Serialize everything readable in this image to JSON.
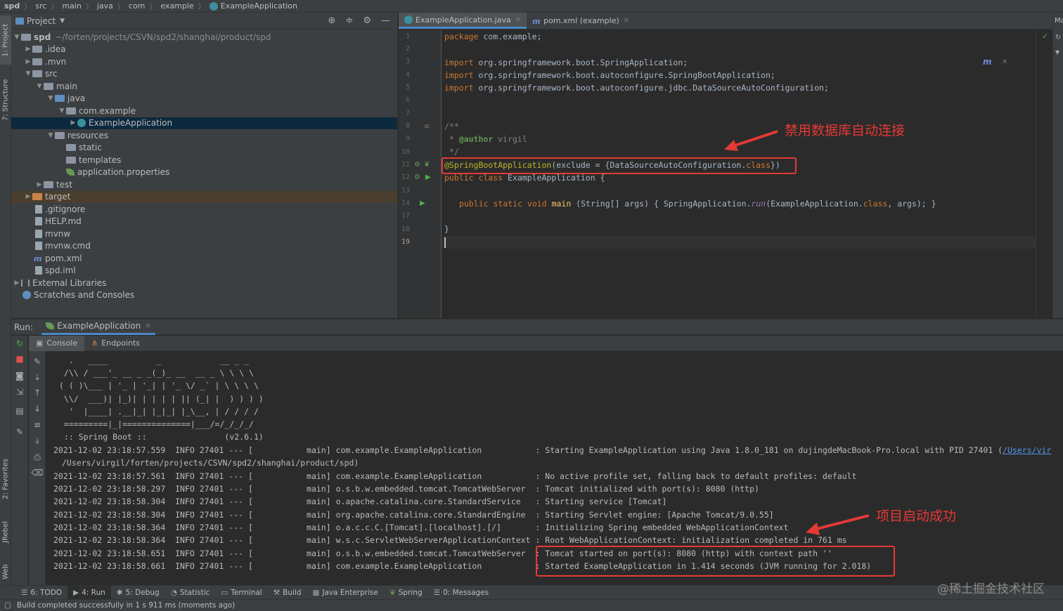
{
  "breadcrumb": [
    "spd",
    "src",
    "main",
    "java",
    "com",
    "example",
    "ExampleApplication"
  ],
  "left_stripe": {
    "project": "1: Project",
    "structure": "7: Structure",
    "favorites": "2: Favorites",
    "jrebel": "JRebel",
    "web": "Web"
  },
  "right_stripe": {
    "maven": "Ma"
  },
  "project_panel": {
    "title": "Project",
    "root_name": "spd",
    "root_path": "~/forten/projects/CSVN/spd2/shanghai/product/spd",
    "tree": [
      {
        "label": "spd",
        "icon": "folder-icon"
      },
      {
        "label": ".idea",
        "icon": "folder-icon"
      },
      {
        "label": ".mvn",
        "icon": "folder-icon"
      },
      {
        "label": "src",
        "icon": "folder-icon"
      },
      {
        "label": "main",
        "icon": "folder-icon"
      },
      {
        "label": "java",
        "icon": "source-folder-icon"
      },
      {
        "label": "com.example",
        "icon": "package-icon"
      },
      {
        "label": "ExampleApplication",
        "icon": "spring-class-icon"
      },
      {
        "label": "resources",
        "icon": "resources-folder-icon"
      },
      {
        "label": "static",
        "icon": "folder-icon"
      },
      {
        "label": "templates",
        "icon": "folder-icon"
      },
      {
        "label": "application.properties",
        "icon": "spring-properties-icon"
      },
      {
        "label": "test",
        "icon": "folder-icon"
      },
      {
        "label": "target",
        "icon": "excluded-folder-icon"
      },
      {
        "label": ".gitignore",
        "icon": "file-icon"
      },
      {
        "label": "HELP.md",
        "icon": "markdown-icon"
      },
      {
        "label": "mvnw",
        "icon": "shell-icon"
      },
      {
        "label": "mvnw.cmd",
        "icon": "file-icon"
      },
      {
        "label": "pom.xml",
        "icon": "maven-icon"
      },
      {
        "label": "spd.iml",
        "icon": "file-icon"
      },
      {
        "label": "External Libraries",
        "icon": "library-icon"
      },
      {
        "label": "Scratches and Consoles",
        "icon": "scratches-icon"
      }
    ]
  },
  "editor": {
    "tabs": [
      {
        "label": "ExampleApplication.java",
        "active": true
      },
      {
        "label": "pom.xml (example)",
        "active": false
      }
    ],
    "line_numbers": [
      "1",
      "2",
      "3",
      "4",
      "5",
      "6",
      "7",
      "8",
      "9",
      "10",
      "11",
      "12",
      "13",
      "14",
      "17",
      "18",
      "19"
    ],
    "code": {
      "l1_kw": "package",
      "l1_rest": " com.example;",
      "l3_kw": "import",
      "l3_rest": " org.springframework.boot.SpringApplication;",
      "l4_kw": "import",
      "l4_rest": " org.springframework.boot.autoconfigure.SpringBootApplication;",
      "l5_kw": "import",
      "l5_rest": " org.springframework.boot.autoconfigure.jdbc.DataSourceAutoConfiguration;",
      "l8": "/**",
      "l9_star": " * ",
      "l9_tag": "@author",
      "l9_name": " virgil",
      "l10": " */",
      "l11_ann": "@SpringBootApplication",
      "l11_mid": "(exclude = {DataSourceAutoConfiguration.",
      "l11_kw": "class",
      "l11_end": "})",
      "l12_kw": "public class",
      "l12_rest": " ExampleApplication {",
      "l14_kw": "public static void",
      "l14_main": "main",
      "l14_args": " (String[] args) { SpringApplication.",
      "l14_run": "run",
      "l14_mid": "(ExampleApplication.",
      "l14_kw2": "class",
      "l14_end": ", args); }",
      "l18": "}"
    },
    "annotation": "禁用数据库自动连接"
  },
  "run": {
    "label": "Run:",
    "config": "ExampleApplication",
    "tabs": [
      "Console",
      "Endpoints"
    ],
    "ascii": "  .   ____          _            __ _ _\n /\\\\ / ___'_ __ _ _(_)_ __  __ _ \\ \\ \\ \\\n( ( )\\___ | '_ | '_| | '_ \\/ _` | \\ \\ \\ \\\n \\\\/  ___)| |_)| | | | | || (_| |  ) ) ) )\n  '  |____| .__|_| |_|_| |_\\__, | / / / /\n =========|_|==============|___/=/_/_/_/\n :: Spring Boot ::                (v2.6.1)",
    "log": [
      "2021-12-02 23:18:57.559  INFO 27401 --- [           main] com.example.ExampleApplication           : Starting ExampleApplication using Java 1.8.0_181 on dujingdeMacBook-Pro.local with PID 27401 (",
      "/Users/virgil/forten/projects/CSVN/spd2/shanghai/product/spd)",
      "2021-12-02 23:18:57.561  INFO 27401 --- [           main] com.example.ExampleApplication           : No active profile set, falling back to default profiles: default",
      "2021-12-02 23:18:58.297  INFO 27401 --- [           main] o.s.b.w.embedded.tomcat.TomcatWebServer  : Tomcat initialized with port(s): 8080 (http)",
      "2021-12-02 23:18:58.304  INFO 27401 --- [           main] o.apache.catalina.core.StandardService   : Starting service [Tomcat]",
      "2021-12-02 23:18:58.304  INFO 27401 --- [           main] org.apache.catalina.core.StandardEngine  : Starting Servlet engine: [Apache Tomcat/9.0.55]",
      "2021-12-02 23:18:58.364  INFO 27401 --- [           main] o.a.c.c.C.[Tomcat].[localhost].[/]       : Initializing Spring embedded WebApplicationContext",
      "2021-12-02 23:18:58.364  INFO 27401 --- [           main] w.s.c.ServletWebServerApplicationContext : Root WebApplicationContext: initialization completed in 761 ms",
      "2021-12-02 23:18:58.651  INFO 27401 --- [           main] o.s.b.w.embedded.tomcat.TomcatWebServer  : Tomcat started on port(s): 8080 (http) with context path ''",
      "2021-12-02 23:18:58.661  INFO 27401 --- [           main] com.example.ExampleApplication           : Started ExampleApplication in 1.414 seconds (JVM running for 2.018)"
    ],
    "log_link": "/Users/vir",
    "annotation": "项目启动成功"
  },
  "tool_tabs": [
    "6: TODO",
    "4: Run",
    "5: Debug",
    "Statistic",
    "Terminal",
    "Build",
    "Java Enterprise",
    "Spring",
    "0: Messages"
  ],
  "status": "Build completed successfully in 1 s 911 ms (moments ago)",
  "watermark": "@稀土掘金技术社区",
  "colors": {
    "annotation_red": "#e53935",
    "keyword": "#cc7832",
    "annotation": "#bbb529",
    "selection": "#0d293e"
  }
}
